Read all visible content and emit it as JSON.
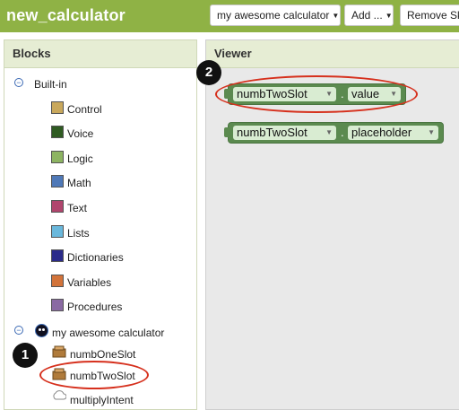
{
  "header": {
    "app_title": "new_calculator",
    "screen_select": "my awesome calculator",
    "add_button": "Add ...",
    "remove_button": "Remove Ski"
  },
  "blocks_panel": {
    "title": "Blocks",
    "builtin": {
      "label": "Built-in",
      "categories": [
        {
          "label": "Control",
          "color": "#c9a85c"
        },
        {
          "label": "Voice",
          "color": "#2f5b22"
        },
        {
          "label": "Logic",
          "color": "#8db462"
        },
        {
          "label": "Math",
          "color": "#4f79b8"
        },
        {
          "label": "Text",
          "color": "#b0456d"
        },
        {
          "label": "Lists",
          "color": "#6ab8dc"
        },
        {
          "label": "Dictionaries",
          "color": "#2b2b8a"
        },
        {
          "label": "Variables",
          "color": "#d2733a"
        },
        {
          "label": "Procedures",
          "color": "#8a6aa3"
        }
      ]
    },
    "screen": {
      "label": "my awesome calculator",
      "components": [
        "numbOneSlot",
        "numbTwoSlot",
        "multiplyIntent"
      ]
    }
  },
  "viewer_panel": {
    "title": "Viewer",
    "blocks": [
      {
        "component": "numbTwoSlot",
        "property": "value"
      },
      {
        "component": "numbTwoSlot",
        "property": "placeholder"
      }
    ]
  },
  "annotations": {
    "step1": "1",
    "step2": "2"
  }
}
